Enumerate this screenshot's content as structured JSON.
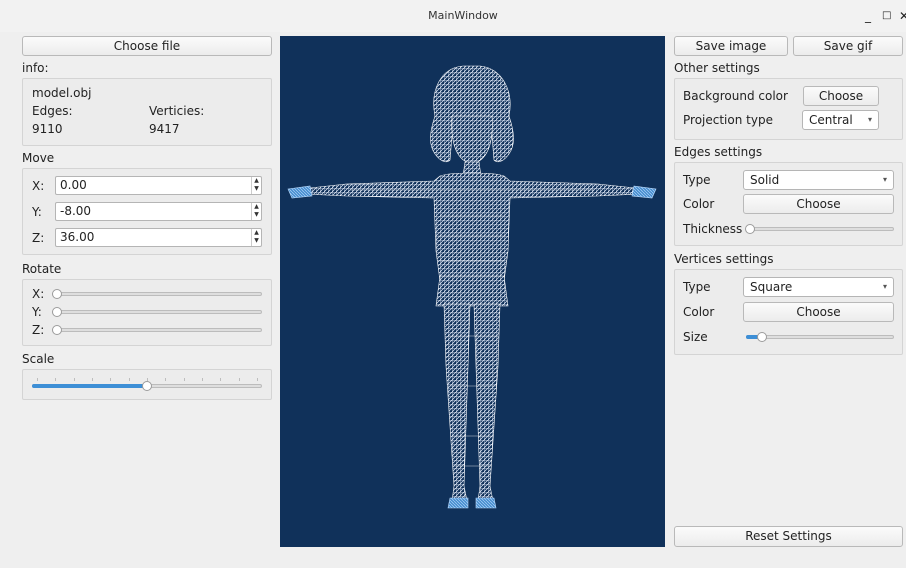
{
  "window": {
    "title": "MainWindow",
    "minimize_glyph": "_",
    "maximize_glyph": "□",
    "close_glyph": "✕"
  },
  "left": {
    "choose_file_label": "Choose file",
    "info_label": "info:",
    "file_name": "model.obj",
    "edges_label": "Edges:",
    "edges_value": "9110",
    "vertices_label": "Verticies:",
    "vertices_value": "9417",
    "move_label": "Move",
    "move": {
      "x_label": "X:",
      "x_value": "0.00",
      "y_label": "Y:",
      "y_value": "-8.00",
      "z_label": "Z:",
      "z_value": "36.00"
    },
    "rotate_label": "Rotate",
    "rotate": {
      "x_label": "X:",
      "y_label": "Y:",
      "z_label": "Z:",
      "x_fraction": 0.0,
      "y_fraction": 0.0,
      "z_fraction": 0.0
    },
    "scale_label": "Scale",
    "scale_fraction": 0.5
  },
  "right": {
    "save_image_label": "Save image",
    "save_gif_label": "Save gif",
    "other_settings_label": "Other settings",
    "background_color_label": "Background color",
    "background_choose_label": "Choose",
    "projection_type_label": "Projection type",
    "projection_value": "Central",
    "edges_settings_label": "Edges settings",
    "edges_type_label": "Type",
    "edges_type_value": "Solid",
    "edges_color_label": "Color",
    "edges_color_choose_label": "Choose",
    "edges_thickness_label": "Thickness",
    "edges_thickness_fraction": 0.0,
    "vertices_settings_label": "Vertices settings",
    "vertices_type_label": "Type",
    "vertices_type_value": "Square",
    "vertices_color_label": "Color",
    "vertices_color_choose_label": "Choose",
    "vertices_size_label": "Size",
    "vertices_size_fraction": 0.08,
    "reset_label": "Reset Settings"
  },
  "colors": {
    "viewport_background": "#10315a",
    "wireframe": "#ffffff",
    "accent": "#3d8fd6"
  }
}
